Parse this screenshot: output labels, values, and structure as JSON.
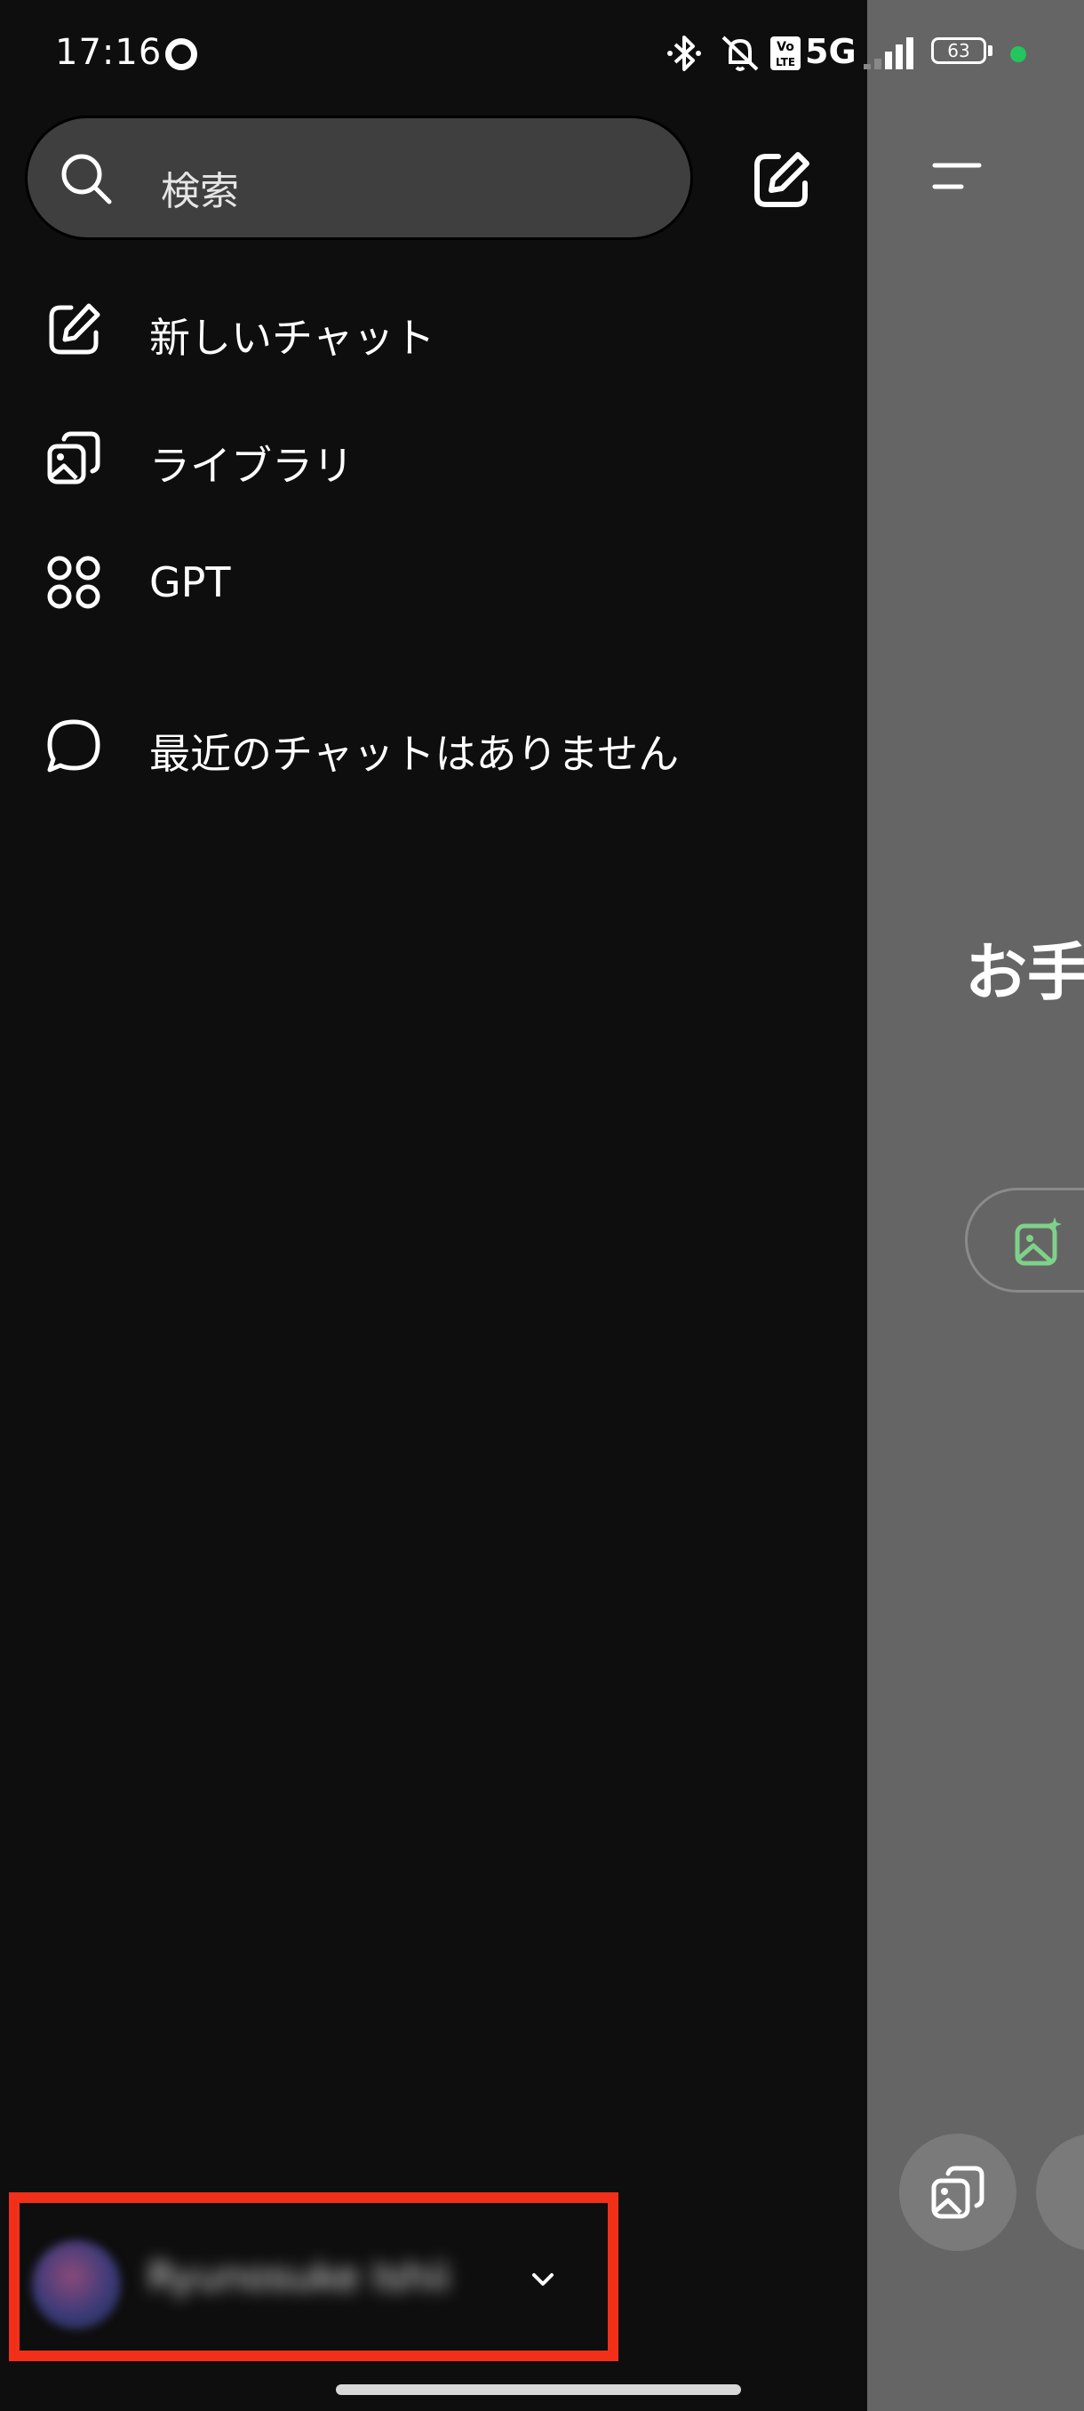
{
  "status_bar": {
    "time": "17:16",
    "network_label": "5G",
    "battery_level": "63",
    "icons": [
      "bluetooth-icon",
      "mute-icon",
      "volte-icon",
      "signal-icon",
      "battery-icon"
    ],
    "dot_color": "#22c55e"
  },
  "search": {
    "placeholder": "検索"
  },
  "menu": {
    "items": [
      {
        "label": "新しいチャット",
        "icon": "new-chat-icon"
      },
      {
        "label": "ライブラリ",
        "icon": "library-icon"
      },
      {
        "label": "GPT",
        "icon": "gpt-grid-icon"
      }
    ],
    "recent_empty": "最近のチャットはありません"
  },
  "profile": {
    "name": "Ryunosuke Ishii",
    "highlight_color": "#f2301a"
  },
  "main_peek": {
    "greeting_partial": "お手"
  }
}
